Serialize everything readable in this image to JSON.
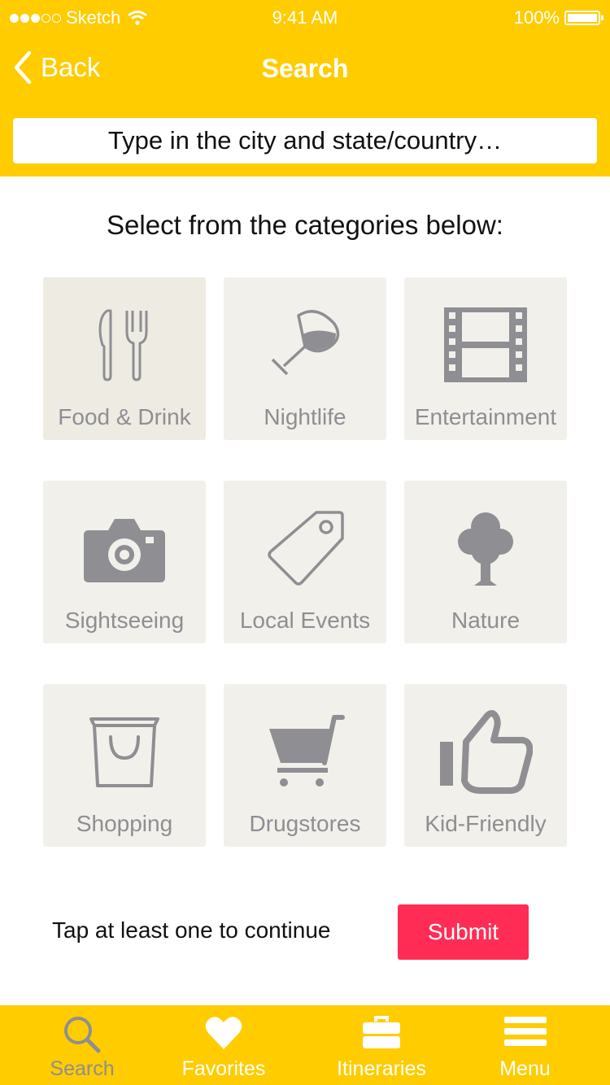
{
  "status_bar": {
    "carrier": "Sketch",
    "time": "9:41 AM",
    "battery": "100%"
  },
  "nav": {
    "back_label": "Back",
    "title": "Search"
  },
  "search": {
    "placeholder": "Type in the city and state/country…"
  },
  "prompt": "Select from the categories below:",
  "categories": [
    {
      "label": "Food & Drink",
      "icon": "fork-knife-icon",
      "selected": true
    },
    {
      "label": "Nightlife",
      "icon": "wine-glass-icon",
      "selected": false
    },
    {
      "label": "Entertainment",
      "icon": "film-strip-icon",
      "selected": false
    },
    {
      "label": "Sightseeing",
      "icon": "camera-icon",
      "selected": false
    },
    {
      "label": "Local Events",
      "icon": "tag-icon",
      "selected": false
    },
    {
      "label": "Nature",
      "icon": "tree-icon",
      "selected": false
    },
    {
      "label": "Shopping",
      "icon": "shopping-bag-icon",
      "selected": false
    },
    {
      "label": "Drugstores",
      "icon": "cart-icon",
      "selected": false
    },
    {
      "label": "Kid-Friendly",
      "icon": "thumbs-up-icon",
      "selected": false
    }
  ],
  "footer": {
    "hint": "Tap at least one to continue",
    "submit_label": "Submit"
  },
  "tabbar": {
    "items": [
      {
        "label": "Search",
        "icon": "search-icon",
        "active": true
      },
      {
        "label": "Favorites",
        "icon": "heart-icon",
        "active": false
      },
      {
        "label": "Itineraries",
        "icon": "briefcase-icon",
        "active": false
      },
      {
        "label": "Menu",
        "icon": "menu-icon",
        "active": false
      }
    ]
  },
  "colors": {
    "brand_yellow": "#FFCC00",
    "tile_bg": "#F1F0EB",
    "icon_gray": "#8E8E93",
    "submit_red": "#FF2D55"
  }
}
